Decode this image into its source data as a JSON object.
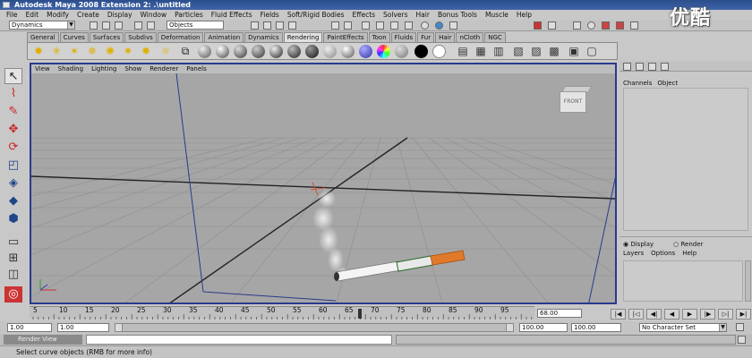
{
  "window": {
    "title": "Autodesk Maya 2008 Extension 2: .\\untitled",
    "watermark": "优酷"
  },
  "menubar": {
    "items": [
      "File",
      "Edit",
      "Modify",
      "Create",
      "Display",
      "Window",
      "Particles",
      "Fluid Effects",
      "Fields",
      "Soft/Rigid Bodies",
      "Effects",
      "Solvers",
      "Hair",
      "Bonus Tools",
      "Muscle",
      "Help"
    ]
  },
  "statusline": {
    "menuset": "Dynamics",
    "selection_mode": "Objects"
  },
  "shelf": {
    "tabs": [
      "General",
      "Curves",
      "Surfaces",
      "Subdivs",
      "Deformation",
      "Animation",
      "Dynamics",
      "Rendering",
      "PaintEffects",
      "Toon",
      "Fluids",
      "Fur",
      "Hair",
      "nCloth",
      "NGC"
    ],
    "active_tab": "Rendering"
  },
  "viewport": {
    "menu": [
      "View",
      "Shading",
      "Lighting",
      "Show",
      "Renderer",
      "Panels"
    ],
    "viewcube_label": "FRONT",
    "border_color": "#2a3a8c",
    "background": "#a6a6a6"
  },
  "channel_box": {
    "menu": [
      "Channels",
      "Object"
    ]
  },
  "layer_editor": {
    "display_label": "Display",
    "render_label": "Render",
    "menu": [
      "Layers",
      "Options",
      "Help"
    ]
  },
  "timeline": {
    "labels": [
      "5",
      "10",
      "15",
      "20",
      "25",
      "30",
      "35",
      "40",
      "45",
      "50",
      "55",
      "60",
      "65",
      "70",
      "75",
      "80",
      "85",
      "90",
      "95"
    ],
    "current_frame": "68.00"
  },
  "range_slider": {
    "start_time": "1.00",
    "playback_start": "1.00",
    "playback_end": "100.00",
    "end_time": "100.00",
    "character_set": "No Character Set"
  },
  "command_line": {
    "language": "Render View"
  },
  "help_line": {
    "text": "Select curve objects (RMB for more info)"
  }
}
